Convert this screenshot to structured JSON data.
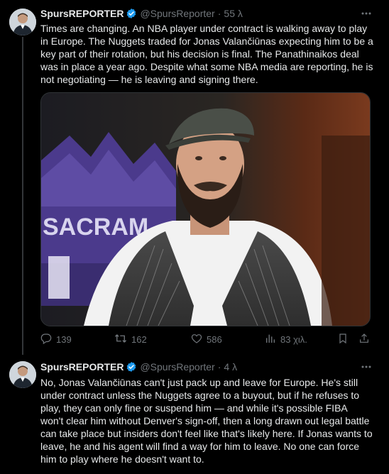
{
  "tweets": [
    {
      "author_name": "SpursREPORTER",
      "handle": "@SpursReporter",
      "time": "55 λ",
      "text": "Times are changing. An NBA player under contract is walking away to play in Europe. The Nuggets traded for Jonas Valančiūnas expecting him to be a key part of their rotation, but his decision is final. The Panathinaikos deal was in place a year ago. Despite what some NBA media are reporting, he is not negotiating — he is leaving and signing there.",
      "media": {
        "watermark_text": "SACRAM"
      },
      "stats": {
        "replies": "139",
        "reposts": "162",
        "likes": "586",
        "views": "83 χιλ."
      }
    },
    {
      "author_name": "SpursREPORTER",
      "handle": "@SpursReporter",
      "time": "4 λ",
      "text": "No, Jonas Valančiūnas can't just pack up and leave for Europe. He's still under contract unless the Nuggets agree to a buyout, but if he refuses to play, they can only fine or suspend him — and while it's possible FIBA won't clear him without Denver's sign-off, then a long drawn out legal battle can take place but insiders don't feel like that's likely here. If Jonas wants to leave, he and his agent will find a way for him to leave. No one can force him to play where he doesn't want to."
    }
  ],
  "colors": {
    "background": "#000000",
    "text": "#e7e9ea",
    "muted": "#71767b",
    "verified": "#1d9bf0",
    "border": "#2f3336"
  },
  "icons": [
    "verified-badge-icon",
    "more-options-icon",
    "reply-icon",
    "repost-icon",
    "like-icon",
    "views-icon",
    "bookmark-icon",
    "share-icon"
  ]
}
